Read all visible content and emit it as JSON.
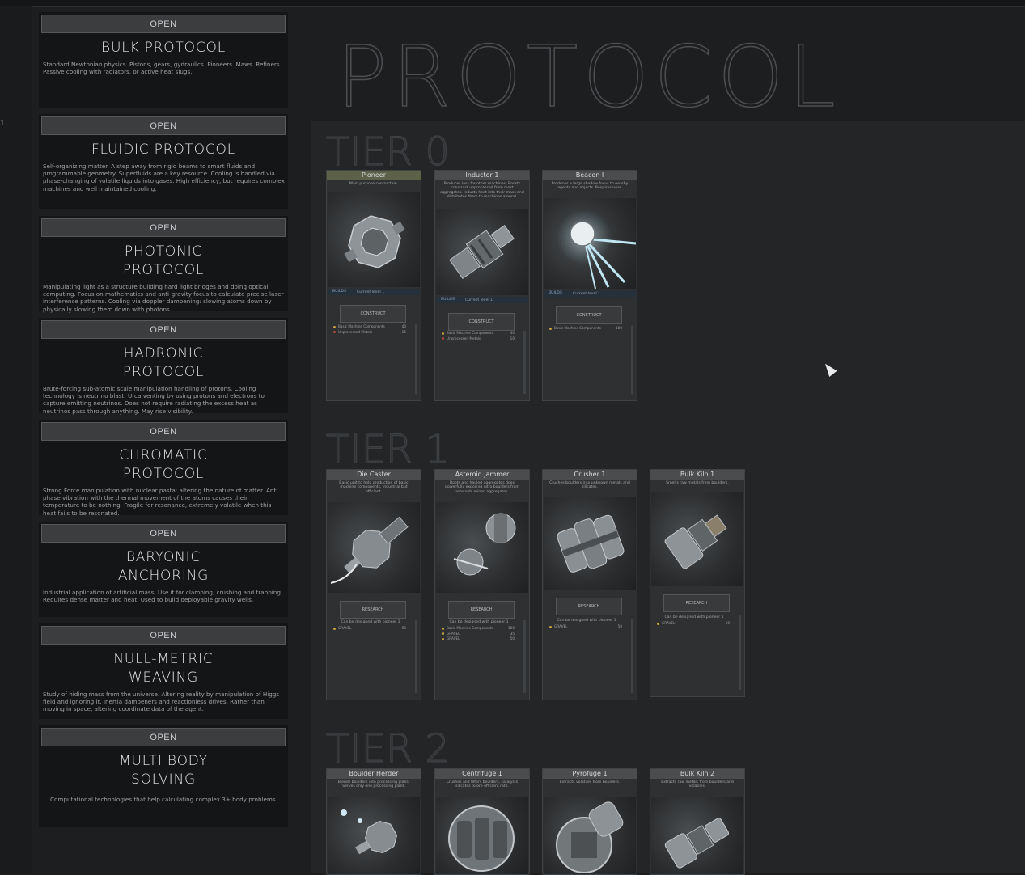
{
  "page": {
    "title": "PROTOCOL"
  },
  "left_edge": {
    "marker": "1"
  },
  "protocols": [
    {
      "button": "OPEN",
      "title": "BULK PROTOCOL",
      "description": "Standard Newtonian physics. Pistons, gears, gydraulics. Pioneers. Maws. Refiners. Passive cooling with radiators, or active heat slugs."
    },
    {
      "button": "OPEN",
      "title": "FLUIDIC PROTOCOL",
      "description": "Self-organizing matter. A step away from rigid beams to smart fluids and programmable geometry. Superfluids are a key resource. Cooling is handled via phase-changing of volatile liquids into gases. High efficiency, but requires complex machines and well maintained cooling."
    },
    {
      "button": "OPEN",
      "title": "PHOTONIC\nPROTOCOL",
      "description": "Manipulating light as a structure building hard light bridges and doing optical computing. Focus on mathematics and anti-gravity focus to calculate precise laser interference patterns. Cooling via doppler dampening: slowing atoms down by physically slowing them down with photons."
    },
    {
      "button": "OPEN",
      "title": "HADRONIC\nPROTOCOL",
      "description": "Brute-forcing sub-atomic scale manipulation handling of protons. Cooling technology is neutrino blast: Urca venting by using protons and electrons to capture emitting neutrinos. Does not require radiating the excess heat as neutrinos pass through anything. May rise visibility."
    },
    {
      "button": "OPEN",
      "title": "CHROMATIC\nPROTOCOL",
      "description": "Strong Force manipulation with nuclear pasta: altering the nature of matter. Anti phase vibration with the thermal movement of the atoms causes their temperature to be nothing. Fragile for resonance, extremely volatile when this heat fails to be resonated."
    },
    {
      "button": "OPEN",
      "title": "BARYONIC\nANCHORING",
      "description": "Industrial application of artificial mass. Use it for clamping, crushing and trapping. Requires dense matter and heat. Used to build deployable gravity wells."
    },
    {
      "button": "OPEN",
      "title": "NULL-METRIC\nWEAVING",
      "description": "Study of hiding mass from the universe. Altering reality by manipulation of Higgs field and ignoring it. Inertia dampeners and reactionless drives. Rather than moving in space, altering coordinate data of the agent."
    },
    {
      "button": "OPEN",
      "title": "MULTI BODY\nSOLVING",
      "description": "Computational technologies that help calculating complex 3+ body problems."
    }
  ],
  "tiers": [
    {
      "label": "TIER 0",
      "cards": [
        {
          "name": "Pioneer",
          "desc": "Main purpose contruction.",
          "meta": "BUILDS",
          "info": "Current level 1",
          "button": "CONSTRUCT",
          "costs": [
            {
              "label": "Basic Machine Components",
              "value": "40"
            },
            {
              "label": "Unprocessed Metals",
              "value": "15"
            }
          ],
          "colors": [
            "#c8a63c",
            "#b04a3a"
          ]
        },
        {
          "name": "Inductor 1",
          "desc": "Produces less for other machines. Boosts construct unprocessed from most aggregates. Inducts heat into their mass and distributes them to machines around.",
          "meta": "BUILDS",
          "info": "Current level 1",
          "button": "CONSTRUCT",
          "costs": [
            {
              "label": "Basic Machine Components",
              "value": "40"
            },
            {
              "label": "Unprocessed Metals",
              "value": "10"
            }
          ],
          "colors": [
            "#c8a63c",
            "#b04a3a"
          ]
        },
        {
          "name": "Beacon I",
          "desc": "Produces a large shadow focus to nearby agents and objects. Requires near.",
          "meta": "BUILDS",
          "info": "Current level 1",
          "button": "CONSTRUCT",
          "costs": [
            {
              "label": "Basic Machine Components",
              "value": "100"
            }
          ],
          "colors": [
            "#c8a63c"
          ]
        }
      ]
    },
    {
      "label": "TIER 1",
      "cards": [
        {
          "name": "Die Caster",
          "desc": "Basic unit to help production of basic machine components. Industrial but efficient.",
          "info": "Can be designed with pioneer 1",
          "button": "RESEARCH",
          "costs": [
            {
              "label": "GRAVEL",
              "value": "50"
            }
          ],
          "colors": [
            "#c8a63c"
          ]
        },
        {
          "name": "Asteroid Jammer",
          "desc": "Boots and hauled aggregates does powerfully exposing nitro boulders from asteroids mined aggregates.",
          "info": "Can be designed with pioneer 1",
          "button": "RESEARCH",
          "costs": [
            {
              "label": "Basic Machine Components",
              "value": "100"
            },
            {
              "label": "GRAVEL",
              "value": "35"
            },
            {
              "label": "GRAVEL",
              "value": "50"
            }
          ],
          "colors": [
            "#c8a63c",
            "#c8a63c",
            "#c8a63c"
          ]
        },
        {
          "name": "Crusher 1",
          "desc": "Crushes boulders into unknown metals and silicates.",
          "info": "Can be designed with pioneer 1",
          "button": "RESEARCH",
          "costs": [
            {
              "label": "GRAVEL",
              "value": "50"
            }
          ],
          "colors": [
            "#c8a63c"
          ]
        },
        {
          "name": "Bulk Kiln 1",
          "desc": "Smelts raw metals from boulders.",
          "info": "Can be designed with pioneer 1",
          "button": "RESEARCH",
          "costs": [
            {
              "label": "GRAVEL",
              "value": "50"
            }
          ],
          "colors": [
            "#c8a63c"
          ]
        }
      ]
    },
    {
      "label": "TIER 2",
      "cards": [
        {
          "name": "Boulder Herder",
          "desc": "Blends boulders into processing plans. Serves only one processing plant."
        },
        {
          "name": "Centrifuge 1",
          "desc": "Crushes and filters boulders, catalysts silicates to ore efficient rate."
        },
        {
          "name": "Pyrofuge 1",
          "desc": "Extracts volatiles from boulders."
        },
        {
          "name": "Bulk Kiln 2",
          "desc": "Extracts raw metals from boulders and volatiles."
        }
      ]
    }
  ]
}
